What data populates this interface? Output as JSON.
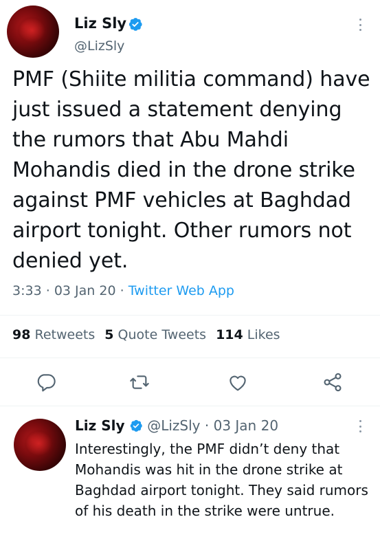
{
  "tweet": {
    "author_name": "Liz Sly",
    "author_handle": "@LizSly",
    "text": "PMF (Shiite militia command) have just issued a statement denying the rumors that Abu Mahdi Mohandis died in the drone strike against PMF vehicles at Baghdad airport tonight. Other rumors not denied yet.",
    "time": "3:33",
    "date": "03 Jan 20",
    "source": "Twitter Web App",
    "sep": "·"
  },
  "stats": {
    "retweets_count": "98",
    "retweets_label": "Retweets",
    "quotes_count": "5",
    "quotes_label": "Quote Tweets",
    "likes_count": "114",
    "likes_label": "Likes"
  },
  "reply": {
    "author_name": "Liz Sly",
    "author_handle": "@LizSly",
    "sep": "·",
    "date": "03 Jan 20",
    "text": "Interestingly, the PMF didn’t deny that Mohandis was hit in the drone  strike at Baghdad airport tonight. They said rumors of his death in the strike were untrue."
  },
  "icons": {
    "verified": "verified-badge-icon",
    "more": "more-icon",
    "reply": "reply-icon",
    "retweet": "retweet-icon",
    "like": "like-icon",
    "share": "share-icon"
  },
  "colors": {
    "accent": "#1d9bf0",
    "text": "#0f1419",
    "secondary": "#536471"
  }
}
